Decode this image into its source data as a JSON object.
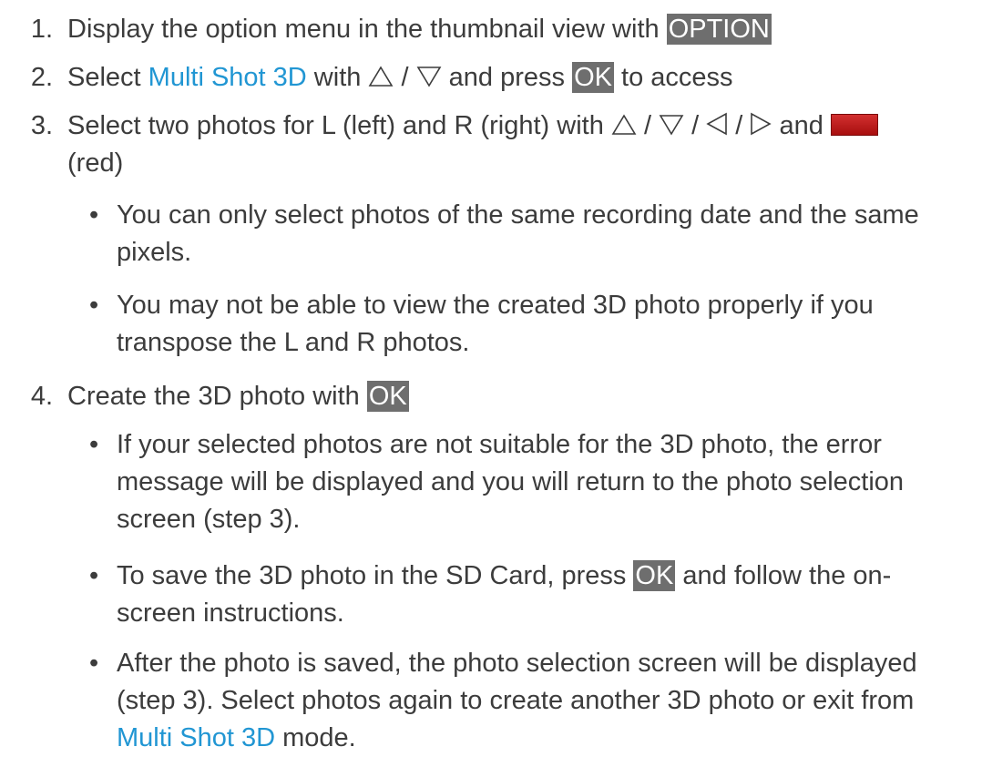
{
  "steps": [
    {
      "num": "1.",
      "parts": [
        "Display the option menu in the thumbnail view with ",
        "OPTION"
      ]
    },
    {
      "num": "2.",
      "parts": [
        "Select ",
        "Multi Shot 3D",
        " with ",
        " / ",
        " and press ",
        "OK",
        " to access"
      ]
    },
    {
      "num": "3.",
      "parts": [
        "Select two photos for L (left) and R (right) with ",
        " / ",
        " / ",
        " / ",
        " and ",
        "(red)"
      ]
    },
    {
      "num": "4.",
      "parts": [
        "Create the 3D photo with ",
        "OK"
      ]
    }
  ],
  "step3_bullets": [
    "You can only select photos of the same recording date and the same pixels.",
    "You may not be able to view the created 3D photo properly if you transpose the L and R photos."
  ],
  "step4_bullets": {
    "b1": "If your selected photos are not suitable for the 3D photo, the error message will be displayed and you will return to the photo selection screen (step 3).",
    "b2_pre": "To save the 3D photo in the SD Card, press ",
    "b2_key": "OK",
    "b2_post": " and follow the on-screen instructions.",
    "b3_pre": "After the photo is saved, the photo selection screen will be displayed (step 3). Select photos again to create another 3D photo or exit from ",
    "b3_link": "Multi Shot 3D",
    "b3_post": " mode."
  },
  "bullet_char": "•",
  "icons": {
    "up": "up-triangle-icon",
    "down": "down-triangle-icon",
    "left": "left-triangle-icon",
    "right": "right-triangle-icon",
    "red": "red-button-icon"
  },
  "colors": {
    "link": "#2196d3",
    "key_bg": "#6e6e6e",
    "text": "#3c3c3c",
    "red": "#c0141c"
  }
}
